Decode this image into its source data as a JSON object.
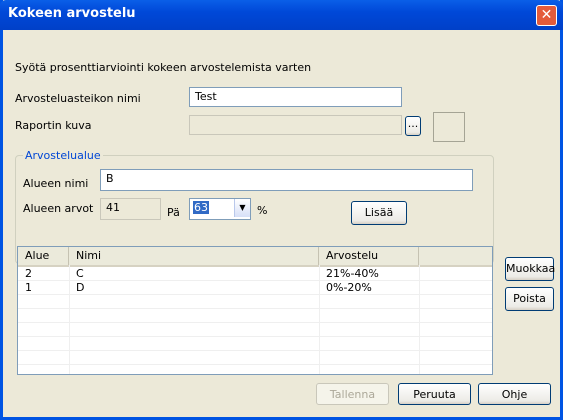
{
  "window": {
    "title": "Kokeen arvostelu"
  },
  "intro": "Syötä prosenttiarviointi kokeen arvostelemista varten",
  "scale_name": {
    "label": "Arvosteluasteikon nimi",
    "value": "Test"
  },
  "report_image": {
    "label": "Raportin kuva",
    "browse_label": "..."
  },
  "range_group": {
    "title": "Arvostelualue",
    "name_label": "Alueen nimi",
    "name_value": "B",
    "values_label": "Alueen arvot",
    "start_value": "41",
    "end_prefix": "Pä",
    "end_value": "63",
    "unit": "%",
    "add_label": "Lisää"
  },
  "table": {
    "columns": [
      "Alue",
      "Nimi",
      "Arvostelu"
    ],
    "rows": [
      [
        "2",
        "C",
        "21%-40%"
      ],
      [
        "1",
        "D",
        "0%-20%"
      ]
    ]
  },
  "side_buttons": {
    "edit": "Muokkaa",
    "remove": "Poista"
  },
  "footer": {
    "save": "Tallenna",
    "cancel": "Peruuta",
    "help": "Ohje"
  },
  "colors": {
    "titlebar": "#0054E3",
    "group_label": "#0046D5",
    "dialog_bg": "#ECE9D8"
  }
}
